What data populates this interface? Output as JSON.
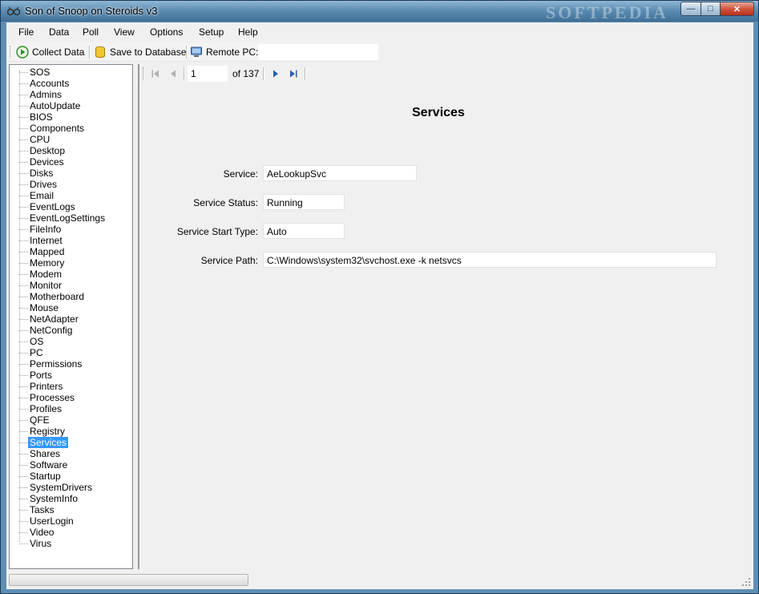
{
  "window": {
    "title": "Son of Snoop on Steroids v3",
    "watermark": "SOFTPEDIA",
    "minimize": "—",
    "maximize": "□",
    "close": "✕"
  },
  "menu": [
    "File",
    "Data",
    "Poll",
    "View",
    "Options",
    "Setup",
    "Help"
  ],
  "toolbar": {
    "collect": "Collect Data",
    "save": "Save to Database",
    "remote": "Remote PC:",
    "remote_value": ""
  },
  "tree": {
    "items": [
      "SOS",
      "Accounts",
      "Admins",
      "AutoUpdate",
      "BIOS",
      "Components",
      "CPU",
      "Desktop",
      "Devices",
      "Disks",
      "Drives",
      "Email",
      "EventLogs",
      "EventLogSettings",
      "FileInfo",
      "Internet",
      "Mapped",
      "Memory",
      "Modem",
      "Monitor",
      "Motherboard",
      "Mouse",
      "NetAdapter",
      "NetConfig",
      "OS",
      "PC",
      "Permissions",
      "Ports",
      "Printers",
      "Processes",
      "Profiles",
      "QFE",
      "Registry",
      "Services",
      "Shares",
      "Software",
      "Startup",
      "SystemDrivers",
      "SystemInfo",
      "Tasks",
      "UserLogin",
      "Video",
      "Virus"
    ],
    "selected": "Services"
  },
  "navigator": {
    "page": "1",
    "of_label": "of 137"
  },
  "report": {
    "title": "Services",
    "service_label": "Service:",
    "service_value": "AeLookupSvc",
    "status_label": "Service Status:",
    "status_value": "Running",
    "start_label": "Service Start Type:",
    "start_value": "Auto",
    "path_label": "Service Path:",
    "path_value": "C:\\Windows\\system32\\svchost.exe -k netsvcs"
  },
  "colors": {
    "selection": "#3399ff",
    "titlebar": "#5c8db2"
  }
}
